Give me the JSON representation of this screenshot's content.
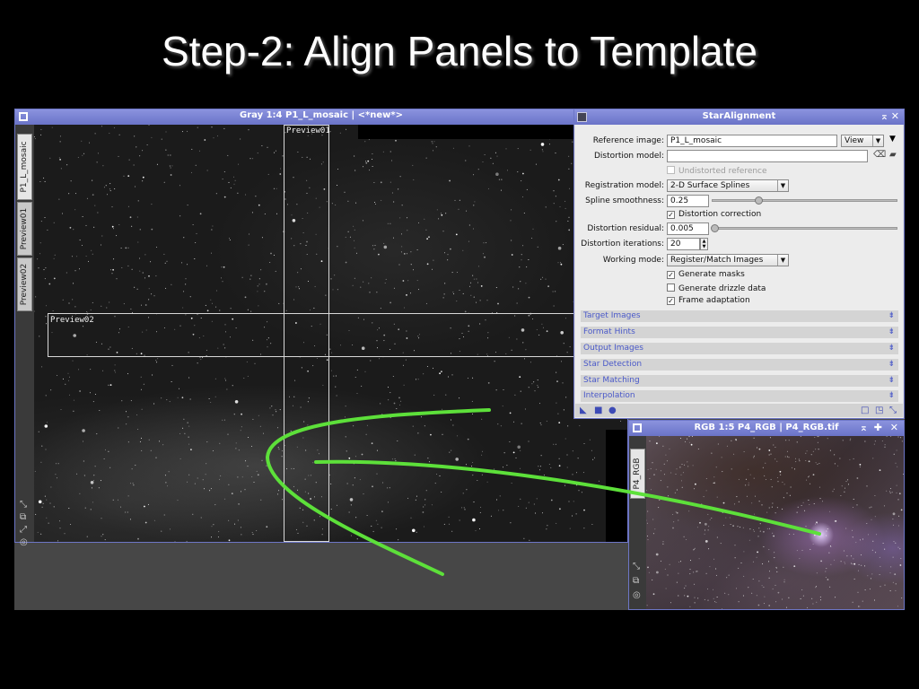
{
  "slide": {
    "title": "Step-2: Align Panels to Template"
  },
  "main_window": {
    "title": "Gray 1:4 P1_L_mosaic | <*new*>",
    "tabs": [
      "P1_L_mosaic",
      "Preview01",
      "Preview02"
    ],
    "preview01_label": "Preview01",
    "preview02_label": "Preview02"
  },
  "star_alignment": {
    "title": "StarAlignment",
    "reference_image_label": "Reference image:",
    "reference_image_value": "P1_L_mosaic",
    "view_button": "View",
    "distortion_model_label": "Distortion model:",
    "distortion_model_value": "",
    "undistorted_reference": "Undistorted reference",
    "registration_model_label": "Registration model:",
    "registration_model_value": "2-D Surface Splines",
    "spline_smoothness_label": "Spline smoothness:",
    "spline_smoothness_value": "0.25",
    "distortion_correction": "Distortion correction",
    "distortion_residual_label": "Distortion residual:",
    "distortion_residual_value": "0.005",
    "distortion_iterations_label": "Distortion iterations:",
    "distortion_iterations_value": "20",
    "working_mode_label": "Working mode:",
    "working_mode_value": "Register/Match Images",
    "generate_masks": "Generate masks",
    "generate_drizzle": "Generate drizzle data",
    "frame_adaptation": "Frame adaptation",
    "sections": [
      "Target Images",
      "Format Hints",
      "Output Images",
      "Star Detection",
      "Star Matching",
      "Interpolation"
    ]
  },
  "rgb_window": {
    "title": "RGB 1:5 P4_RGB | P4_RGB.tif",
    "tab": "P4_RGB"
  },
  "colors": {
    "titlebar": "#6d76c6",
    "arrow": "#5de03a",
    "section_text": "#4a59c9"
  }
}
